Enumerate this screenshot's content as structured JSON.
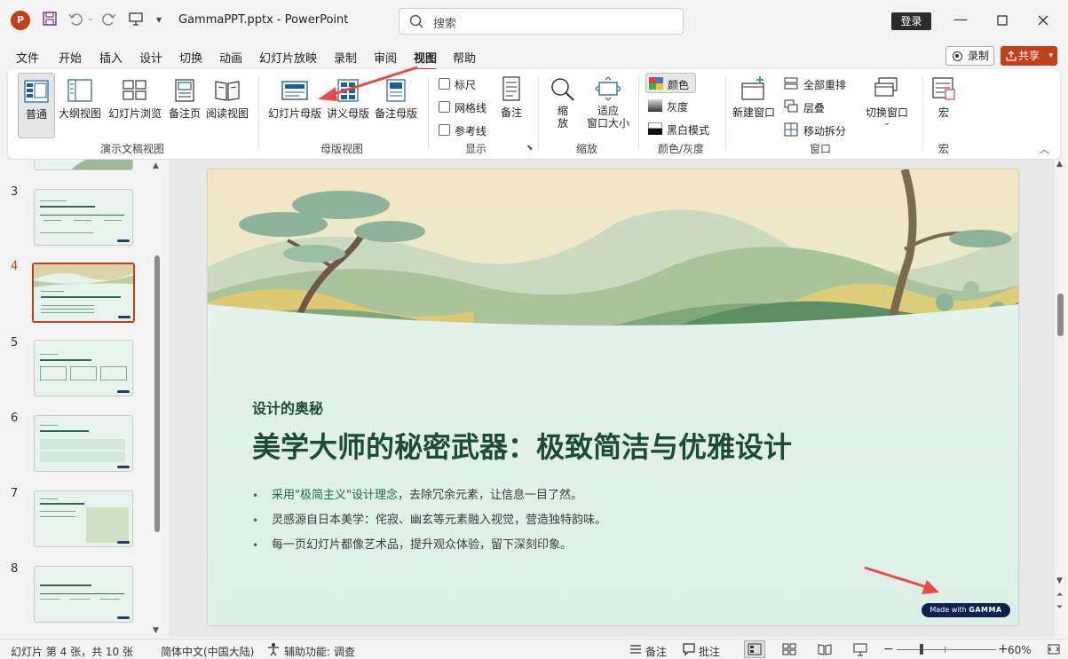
{
  "titlebar": {
    "app_logo": "P",
    "doc_title": "GammaPPT.pptx  -  PowerPoint",
    "search_placeholder": "搜索",
    "login_label": "登录",
    "icons": [
      "save-icon",
      "undo-icon",
      "redo-icon",
      "present-icon",
      "customize-qat-icon",
      "minimize-icon",
      "maximize-icon",
      "close-icon"
    ]
  },
  "tabs": [
    "文件",
    "开始",
    "插入",
    "设计",
    "切换",
    "动画",
    "幻灯片放映",
    "录制",
    "审阅",
    "视图",
    "帮助"
  ],
  "active_tab": "视图",
  "record_label": "录制",
  "share_label": "共享",
  "ribbon": {
    "presentation_views": {
      "label": "演示文稿视图",
      "buttons": [
        "普通",
        "大纲视图",
        "幻灯片浏览",
        "备注页",
        "阅读视图"
      ]
    },
    "master_views": {
      "label": "母版视图",
      "buttons": [
        "幻灯片母版",
        "讲义母版",
        "备注母版"
      ]
    },
    "show": {
      "label": "显示",
      "checks": [
        "标尺",
        "网格线",
        "参考线"
      ],
      "notes": "备注"
    },
    "zoom": {
      "label": "缩放",
      "zoom_line1": "缩",
      "zoom_line2": "放",
      "fit_line1": "适应",
      "fit_line2": "窗口大小"
    },
    "color": {
      "label": "颜色/灰度",
      "color": "颜色",
      "gray": "灰度",
      "bw": "黑白模式"
    },
    "window": {
      "label": "窗口",
      "new_window": "新建窗口",
      "arrange_all": "全部重排",
      "cascade": "层叠",
      "move_split": "移动拆分",
      "switch_windows": "切换窗口"
    },
    "macros": {
      "label": "宏",
      "macros": "宏"
    }
  },
  "thumbnails": {
    "numbers": [
      "3",
      "4",
      "5",
      "6",
      "7",
      "8"
    ],
    "active": "4"
  },
  "slide": {
    "subtitle": "设计的奥秘",
    "title": "美学大师的秘密武器：极致简洁与优雅设计",
    "bullet1_highlight": "采用\"极简主义\"设计理念",
    "bullet1_rest": "，去除冗余元素，让信息一目了然。",
    "bullet2": "灵感源自日本美学：侘寂、幽玄等元素融入视觉，营造独特韵味。",
    "bullet3": "每一页幻灯片都像艺术品，提升观众体验，留下深刻印象。",
    "badge_prefix": "Made with",
    "badge_brand": "GAMMA"
  },
  "statusbar": {
    "slide_info": "幻灯片 第 4 张，共 10 张",
    "language": "简体中文(中国大陆)",
    "accessibility": "辅助功能: 调查",
    "notes": "备注",
    "comments": "批注",
    "zoom": "60%"
  },
  "colors": {
    "accent": "#c43e1c",
    "slide_title": "#1b4d36",
    "badge": "#0e2352",
    "annotation": "#e84a45"
  }
}
